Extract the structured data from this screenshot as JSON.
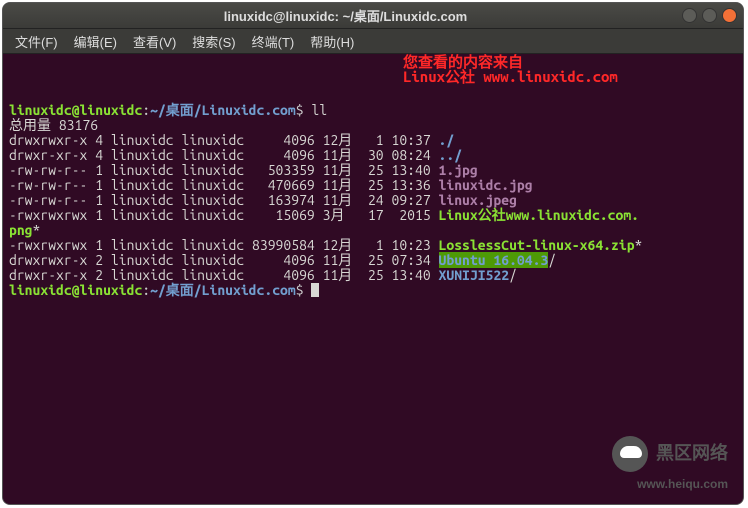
{
  "window": {
    "title": "linuxidc@linuxidc: ~/桌面/Linuxidc.com"
  },
  "menu": [
    "文件(F)",
    "编辑(E)",
    "查看(V)",
    "搜索(S)",
    "终端(T)",
    "帮助(H)"
  ],
  "prompt_user": "linuxidc@linuxidc",
  "prompt_path": "~/桌面/Linuxidc.com",
  "cmd": "ll",
  "total_label": "总用量 83176",
  "entries": [
    {
      "perm": "drwxrwxr-x",
      "links": "4",
      "own": "linuxidc",
      "grp": "linuxidc",
      "size": "4096",
      "mon": "12月",
      "day": "1",
      "time": "10:37",
      "name": "./",
      "cls": "dir",
      "suffix": ""
    },
    {
      "perm": "drwxr-xr-x",
      "links": "4",
      "own": "linuxidc",
      "grp": "linuxidc",
      "size": "4096",
      "mon": "11月",
      "day": "30",
      "time": "08:24",
      "name": "../",
      "cls": "dir",
      "suffix": ""
    },
    {
      "perm": "-rw-rw-r--",
      "links": "1",
      "own": "linuxidc",
      "grp": "linuxidc",
      "size": "503359",
      "mon": "11月",
      "day": "25",
      "time": "13:40",
      "name": "1.jpg",
      "cls": "pic",
      "suffix": ""
    },
    {
      "perm": "-rw-rw-r--",
      "links": "1",
      "own": "linuxidc",
      "grp": "linuxidc",
      "size": "470669",
      "mon": "11月",
      "day": "25",
      "time": "13:36",
      "name": "linuxidc.jpg",
      "cls": "pic",
      "suffix": ""
    },
    {
      "perm": "-rw-rw-r--",
      "links": "1",
      "own": "linuxidc",
      "grp": "linuxidc",
      "size": "163974",
      "mon": "11月",
      "day": "24",
      "time": "09:27",
      "name": "linux.jpeg",
      "cls": "pic",
      "suffix": ""
    },
    {
      "perm": "-rwxrwxrwx",
      "links": "1",
      "own": "linuxidc",
      "grp": "linuxidc",
      "size": "15069",
      "mon": "3月 ",
      "day": "17",
      "time": "2015",
      "name": "Linux公社www.linuxidc.com.png",
      "cls": "exec",
      "suffix": "*",
      "wrap": true
    },
    {
      "perm": "-rwxrwxrwx",
      "links": "1",
      "own": "linuxidc",
      "grp": "linuxidc",
      "size": "83990584",
      "mon": "12月",
      "day": "1",
      "time": "10:23",
      "name": "LosslessCut-linux-x64.zip",
      "cls": "exec",
      "suffix": "*"
    },
    {
      "perm": "drwxrwxr-x",
      "links": "2",
      "own": "linuxidc",
      "grp": "linuxidc",
      "size": "4096",
      "mon": "11月",
      "day": "25",
      "time": "07:34",
      "name": "Ubuntu 16.04.3",
      "cls": "otherw",
      "suffix": "/"
    },
    {
      "perm": "drwxr-xr-x",
      "links": "2",
      "own": "linuxidc",
      "grp": "linuxidc",
      "size": "4096",
      "mon": "11月",
      "day": "25",
      "time": "13:40",
      "name": "XUNIJI522",
      "cls": "dir",
      "suffix": "/"
    }
  ],
  "watermark": {
    "l1": "您查看的内容来自",
    "l2": "Linux公社 www.linuxidc.com",
    "brand1": "黑区网络",
    "brand2": "www.heiqu.com"
  }
}
